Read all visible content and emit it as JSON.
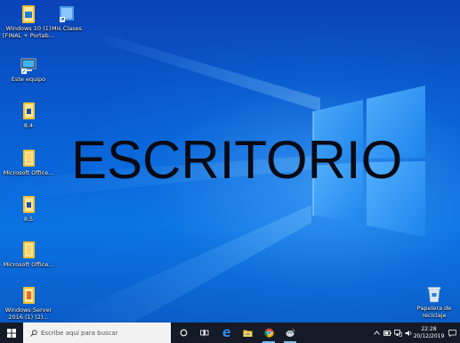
{
  "wallpaper": {
    "caption": "ESCRITORIO"
  },
  "desktop_icons": [
    {
      "label": "Windows 10 (1) [FINAL + Portab...",
      "icon": "folder-icon"
    },
    {
      "label": "Mis Clases",
      "icon": "shortcut-icon"
    },
    {
      "label": "Este equipo",
      "icon": "computer-icon"
    },
    {
      "label": "8.4",
      "icon": "folder-icon"
    },
    {
      "label": "Microsoft Office...",
      "icon": "folder-icon"
    },
    {
      "label": "8.5",
      "icon": "folder-icon"
    },
    {
      "label": "Microsoft Office...",
      "icon": "folder-icon"
    },
    {
      "label": "Windows Server 2016 (1) (2)...",
      "icon": "folder-icon"
    },
    {
      "label": "Papelera de reciclaje",
      "icon": "recycle-bin-icon"
    }
  ],
  "taskbar": {
    "search_placeholder": "Escribe aquí para buscar",
    "apps": [
      "task-view-icon",
      "edge-icon",
      "file-explorer-icon",
      "chrome-icon",
      "paint-icon"
    ],
    "clock_time": "22:28",
    "clock_date": "20/12/2019"
  },
  "colors": {
    "taskbar": "#141b27",
    "wallpaper_top": "#0a43b8",
    "wallpaper_glow": "#5ab4ff"
  }
}
